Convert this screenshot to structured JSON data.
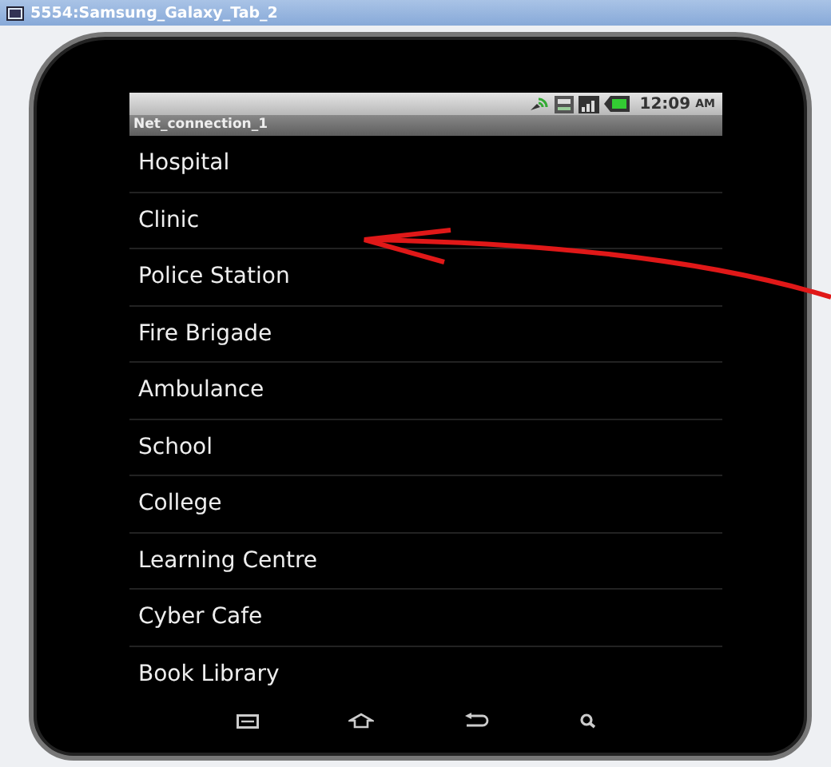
{
  "window": {
    "title": "5554:Samsung_Galaxy_Tab_2"
  },
  "status_bar": {
    "time": "12:09",
    "ampm": "AM"
  },
  "app": {
    "title": "Net_connection_1"
  },
  "list": [
    {
      "label": "Hospital"
    },
    {
      "label": "Clinic"
    },
    {
      "label": "Police Station"
    },
    {
      "label": "Fire Brigade"
    },
    {
      "label": "Ambulance"
    },
    {
      "label": "School"
    },
    {
      "label": "College"
    },
    {
      "label": "Learning Centre"
    },
    {
      "label": "Cyber Cafe"
    },
    {
      "label": "Book Library"
    }
  ]
}
